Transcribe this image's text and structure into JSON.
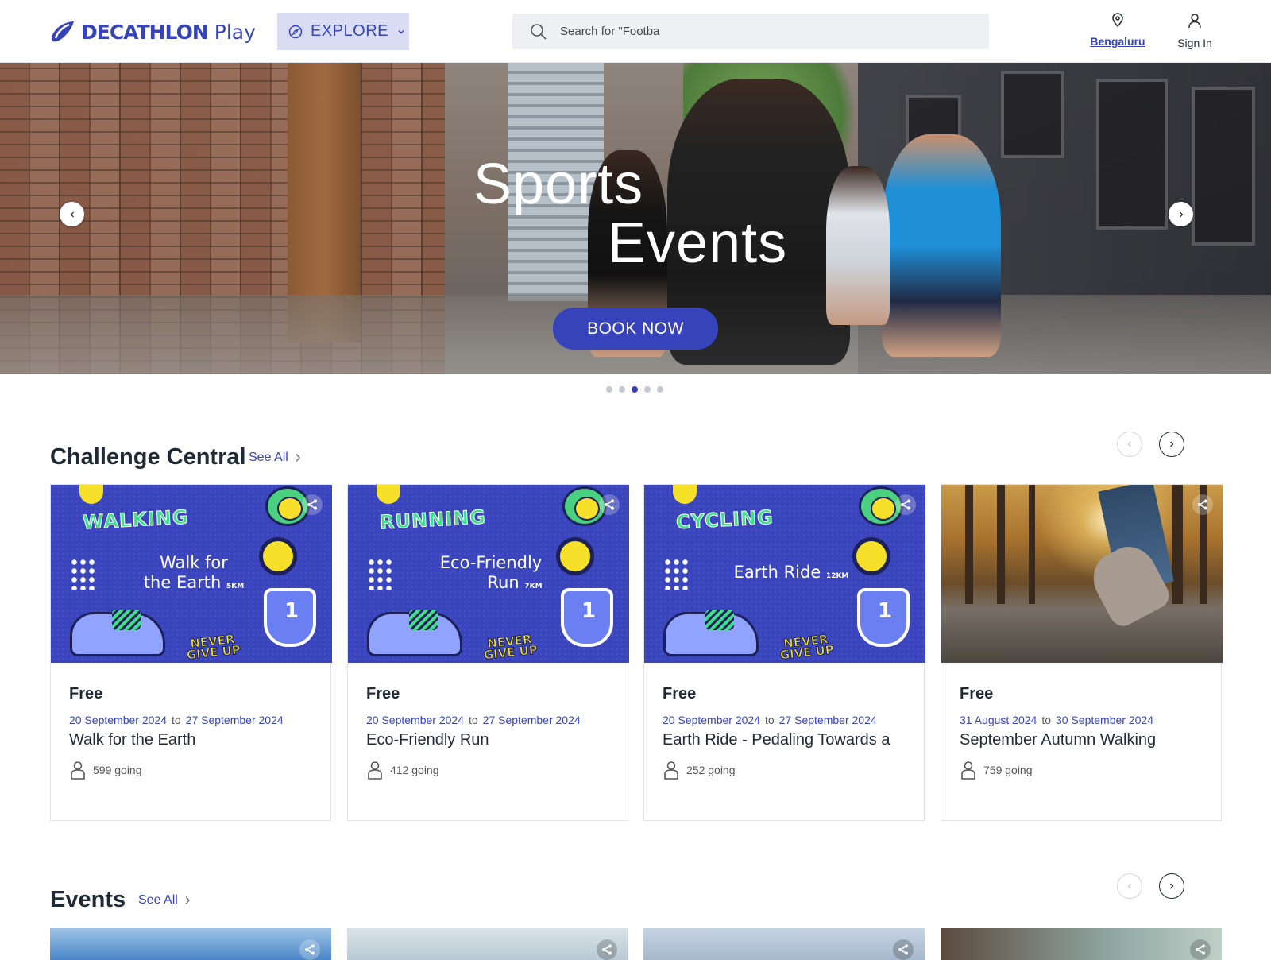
{
  "header": {
    "brand": "DECATHLON",
    "brand_suffix": "Play",
    "explore_label": "EXPLORE",
    "search_placeholder": "Search for \"Footba",
    "location": "Bengaluru",
    "signin": "Sign In"
  },
  "hero": {
    "title_line1": "Sports",
    "title_line2": "Events",
    "cta": "BOOK NOW",
    "slides": 5,
    "active_slide": 3
  },
  "challenge": {
    "title": "Challenge Central",
    "see_all": "See All",
    "cards": [
      {
        "price": "Free",
        "start": "20 September 2024",
        "to": "to",
        "end": "27 September 2024",
        "name": "Walk for the Earth",
        "going": "599 going",
        "art_category": "WALKING",
        "art_line1": "Walk for",
        "art_line2": "the Earth",
        "art_dist": "5KM"
      },
      {
        "price": "Free",
        "start": "20 September 2024",
        "to": "to",
        "end": "27 September 2024",
        "name": "Eco-Friendly Run",
        "going": "412 going",
        "art_category": "RUNNING",
        "art_line1": "Eco-Friendly",
        "art_line2": "Run",
        "art_dist": "7KM"
      },
      {
        "price": "Free",
        "start": "20 September 2024",
        "to": "to",
        "end": "27 September 2024",
        "name": "Earth Ride - Pedaling Towards a",
        "going": "252 going",
        "art_category": "CYCLING",
        "art_line1": "Earth Ride",
        "art_line2": "",
        "art_dist": "12KM"
      },
      {
        "price": "Free",
        "start": "31 August 2024",
        "to": "to",
        "end": "30 September 2024",
        "name": "September Autumn Walking",
        "going": "759 going"
      }
    ],
    "art_badge_line1": "NEVER",
    "art_badge_line2": "GIVE UP"
  },
  "events": {
    "title": "Events",
    "see_all": "See All"
  },
  "colors": {
    "brand": "#3643ba",
    "explore_bg": "#dadcf3"
  }
}
